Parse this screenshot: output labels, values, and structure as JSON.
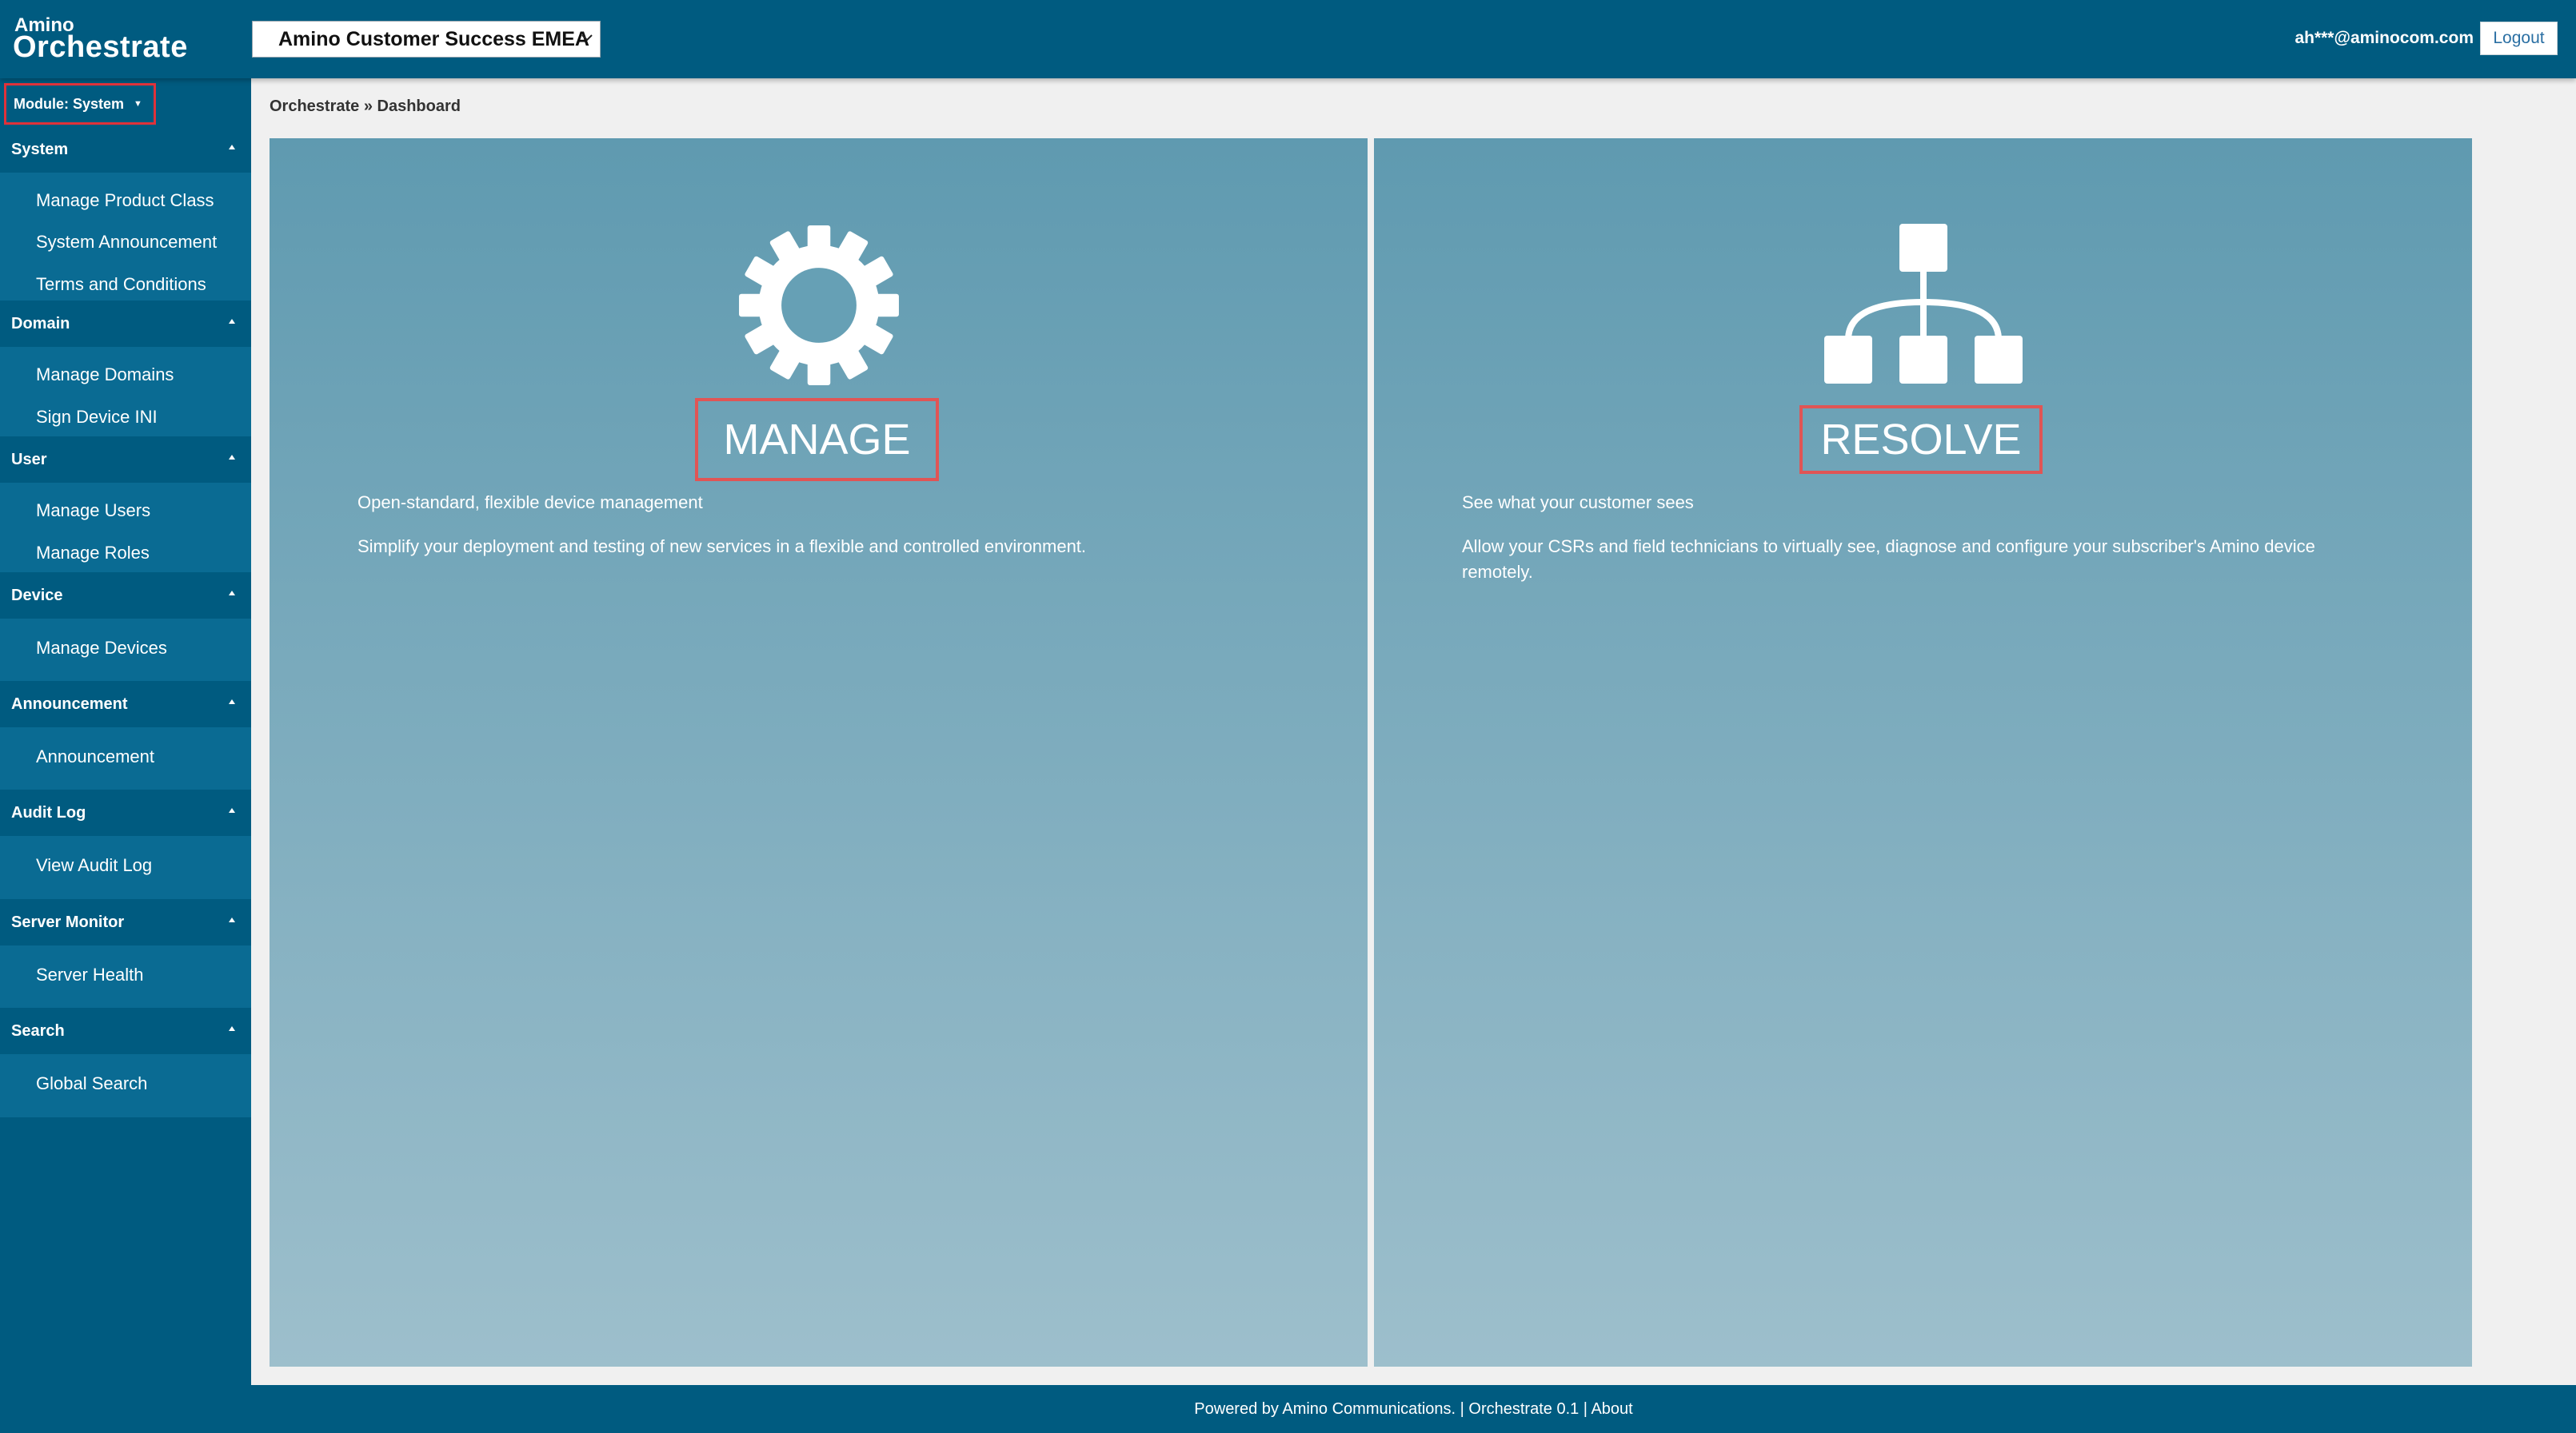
{
  "app": {
    "logo_small": "Amino",
    "logo_big": "Orchestrate"
  },
  "header": {
    "org_selected": "Amino Customer Success EMEA",
    "user_email": "ah***@aminocom.com",
    "logout_label": "Logout"
  },
  "sidebar": {
    "module_label": "Module: System",
    "sections": [
      {
        "title": "System",
        "items": [
          "Manage Product Class",
          "System Announcement",
          "Terms and Conditions"
        ]
      },
      {
        "title": "Domain",
        "items": [
          "Manage Domains",
          "Sign Device INI"
        ]
      },
      {
        "title": "User",
        "items": [
          "Manage Users",
          "Manage Roles"
        ]
      },
      {
        "title": "Device",
        "items": [
          "Manage Devices"
        ]
      },
      {
        "title": "Announcement",
        "items": [
          "Announcement"
        ]
      },
      {
        "title": "Audit Log",
        "items": [
          "View Audit Log"
        ]
      },
      {
        "title": "Server Monitor",
        "items": [
          "Server Health"
        ]
      },
      {
        "title": "Search",
        "items": [
          "Global Search"
        ]
      }
    ]
  },
  "main": {
    "breadcrumb": "Orchestrate » Dashboard",
    "panels": [
      {
        "icon": "gear-icon",
        "title": "MANAGE",
        "subtitle": "Open-standard, flexible device management",
        "description": "Simplify your deployment and testing of new services in a flexible and controlled environment."
      },
      {
        "icon": "hierarchy-icon",
        "title": "RESOLVE",
        "subtitle": "See what your customer sees",
        "description": "Allow your CSRs and field technicians to virtually see, diagnose and configure your subscriber's Amino device remotely."
      }
    ]
  },
  "footer": {
    "text": "Powered by Amino Communications. | Orchestrate 0.1 | About"
  },
  "colors": {
    "brand": "#005b80",
    "panel_top": "#5f9ab0",
    "panel_bottom": "#9dbfcc",
    "highlight": "#e0323a"
  }
}
